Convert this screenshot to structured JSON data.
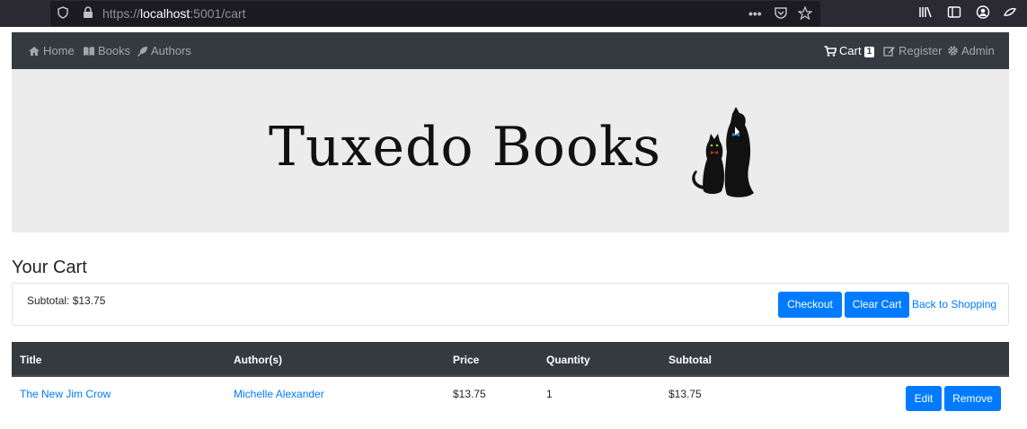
{
  "browser": {
    "url_scheme": "https://",
    "url_host": "localhost",
    "url_rest": ":5001/cart"
  },
  "nav": {
    "home": "Home",
    "books": "Books",
    "authors": "Authors",
    "cart": "Cart",
    "cart_count": "1",
    "register": "Register",
    "admin": "Admin"
  },
  "banner": {
    "logo_text": "Tuxedo Books"
  },
  "page": {
    "heading": "Your Cart"
  },
  "summary": {
    "subtotal": "Subtotal: $13.75",
    "checkout_label": "Checkout",
    "clear_label": "Clear Cart",
    "back_label": "Back to Shopping"
  },
  "table": {
    "headers": [
      "Title",
      "Author(s)",
      "Price",
      "Quantity",
      "Subtotal"
    ],
    "rows": [
      {
        "title": "The New Jim Crow",
        "authors": "Michelle Alexander",
        "price": "$13.75",
        "quantity": "1",
        "subtotal": "$13.75",
        "edit_label": "Edit",
        "remove_label": "Remove"
      }
    ]
  },
  "colors": {
    "navbar": "#343a40",
    "primary": "#007bff",
    "banner": "#ececec"
  }
}
